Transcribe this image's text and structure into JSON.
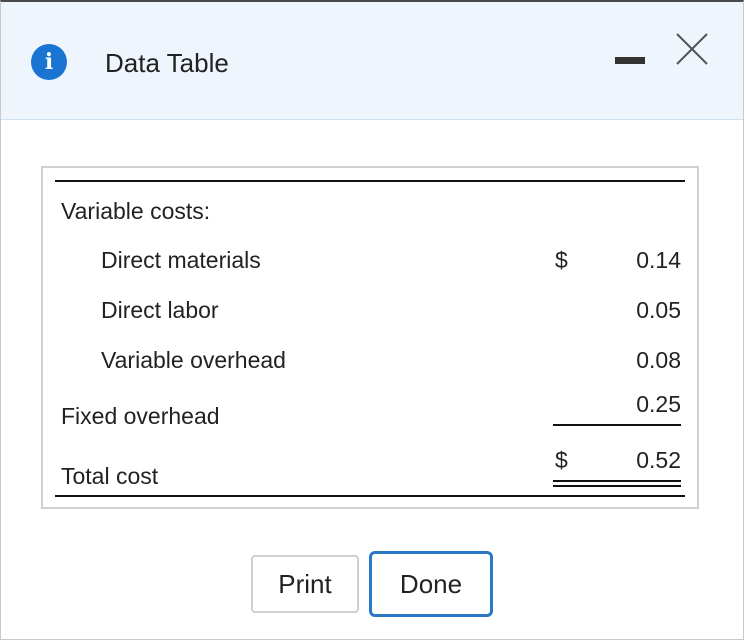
{
  "window": {
    "title": "Data Table",
    "icons": {
      "info": "info-icon",
      "minimize": "minimize-icon",
      "close": "close-icon"
    },
    "accent_color": "#1a74d2"
  },
  "table": {
    "section_label": "Variable costs:",
    "variable_items": [
      {
        "label": "Direct materials",
        "currency": "$",
        "value": "0.14"
      },
      {
        "label": "Direct labor",
        "currency": "",
        "value": "0.05"
      },
      {
        "label": "Variable overhead",
        "currency": "",
        "value": "0.08"
      }
    ],
    "fixed": {
      "label": "Fixed overhead",
      "value": "0.25"
    },
    "total": {
      "label": "Total cost",
      "currency": "$",
      "value": "0.52"
    }
  },
  "buttons": {
    "print": "Print",
    "done": "Done"
  }
}
